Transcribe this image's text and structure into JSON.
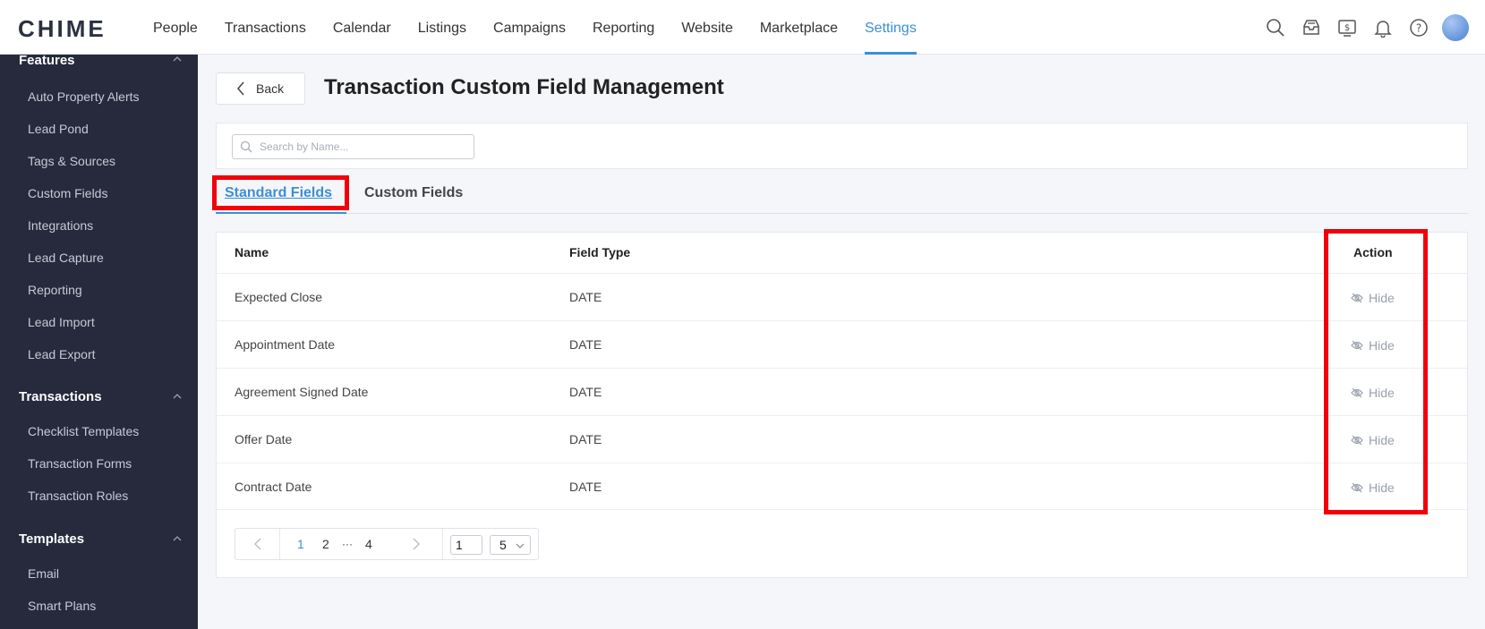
{
  "app": {
    "logo": "CHIME"
  },
  "nav": {
    "items": [
      "People",
      "Transactions",
      "Calendar",
      "Listings",
      "Campaigns",
      "Reporting",
      "Website",
      "Marketplace",
      "Settings"
    ],
    "active": "Settings"
  },
  "top_icons": [
    "search-icon",
    "inbox-icon",
    "billing-icon",
    "bell-icon",
    "help-icon",
    "avatar"
  ],
  "sidebar": {
    "sections": [
      {
        "title": "Features",
        "items": [
          "Auto Property Alerts",
          "Lead Pond",
          "Tags & Sources",
          "Custom Fields",
          "Integrations",
          "Lead Capture",
          "Reporting",
          "Lead Import",
          "Lead Export"
        ]
      },
      {
        "title": "Transactions",
        "items": [
          "Checklist Templates",
          "Transaction Forms",
          "Transaction Roles"
        ]
      },
      {
        "title": "Templates",
        "items": [
          "Email",
          "Smart Plans"
        ]
      }
    ]
  },
  "header": {
    "back_label": "Back",
    "title": "Transaction Custom Field Management"
  },
  "search": {
    "placeholder": "Search by Name...",
    "value": ""
  },
  "tabs": [
    {
      "label": "Standard Fields",
      "active": true
    },
    {
      "label": "Custom Fields",
      "active": false
    }
  ],
  "table": {
    "columns": [
      "Name",
      "Field Type",
      "Action"
    ],
    "rows": [
      {
        "name": "Expected Close",
        "type": "DATE",
        "action": "Hide"
      },
      {
        "name": "Appointment Date",
        "type": "DATE",
        "action": "Hide"
      },
      {
        "name": "Agreement Signed Date",
        "type": "DATE",
        "action": "Hide"
      },
      {
        "name": "Offer Date",
        "type": "DATE",
        "action": "Hide"
      },
      {
        "name": "Contract Date",
        "type": "DATE",
        "action": "Hide"
      }
    ]
  },
  "pagination": {
    "pages": [
      "1",
      "2",
      "···",
      "4"
    ],
    "current": "1",
    "goto_value": "1",
    "page_size": "5"
  },
  "colors": {
    "accent": "#3b8fd6",
    "sidebar_bg": "#262a3c",
    "highlight": "#f2000a"
  }
}
